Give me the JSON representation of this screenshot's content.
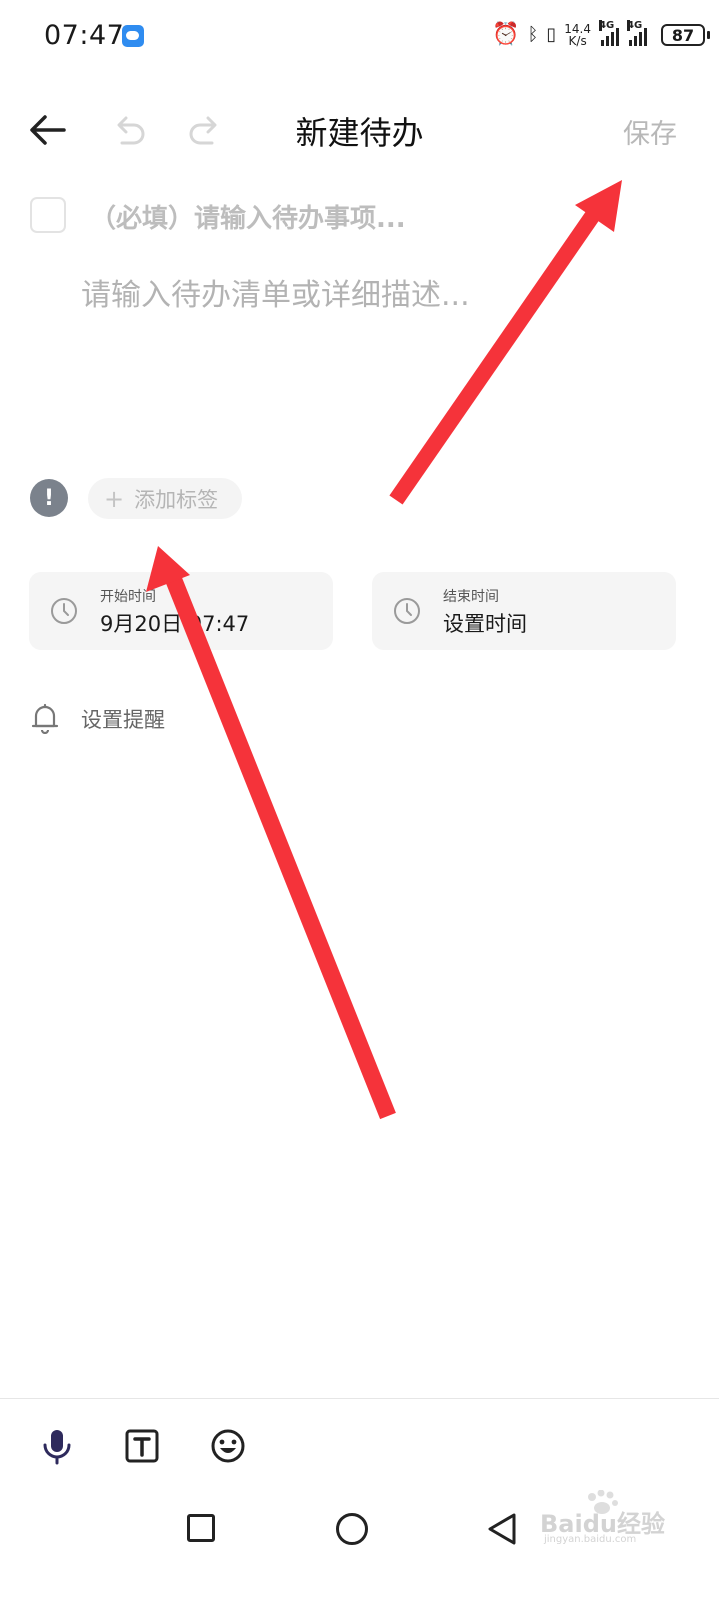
{
  "status_bar": {
    "time": "07:47",
    "net_speed_top": "14.4",
    "net_speed_bottom": "K/s",
    "sig1_label": "4G",
    "sig2_label": "4G",
    "battery": "87"
  },
  "header": {
    "title": "新建待办",
    "save_label": "保存"
  },
  "task": {
    "title_placeholder": "（必填）请输入待办事项...",
    "desc_placeholder": "请输入待办清单或详细描述..."
  },
  "tags": {
    "add_label": "添加标签"
  },
  "time": {
    "start_label": "开始时间",
    "start_value": "9月20日 07:47",
    "end_label": "结束时间",
    "end_value": "设置时间"
  },
  "reminder": {
    "label": "设置提醒"
  },
  "watermark": {
    "brand": "Baidu经验",
    "url": "jingyan.baidu.com"
  },
  "colors": {
    "accent_arrow": "#f5333a",
    "muted_text": "#b8b8b8",
    "priority_icon": "#7b828c"
  },
  "icons": [
    "back-arrow-icon",
    "undo-icon",
    "redo-icon",
    "clock-icon",
    "bell-icon",
    "mic-icon",
    "text-format-icon",
    "emoji-icon"
  ]
}
